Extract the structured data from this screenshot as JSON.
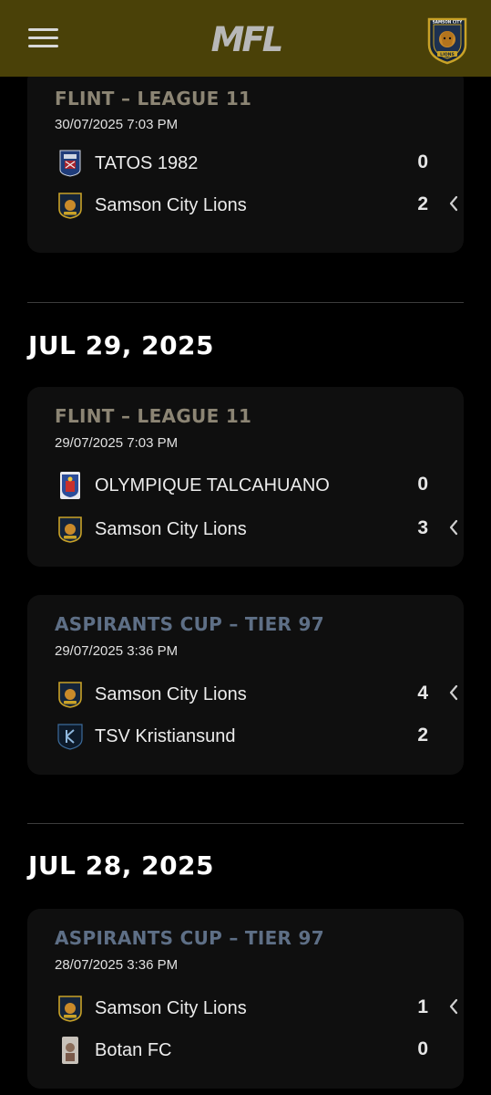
{
  "header": {
    "logo_text": "MFL",
    "club_badge": {
      "top": "SAMSON CITY",
      "bottom": "LIONS"
    }
  },
  "colors": {
    "header_bg": "#4a4108",
    "league_title": "#8c8574",
    "cup_title": "#5e6f86",
    "card_bg": "#0f0f0f"
  },
  "matches": [
    {
      "competition": "FLINT – LEAGUE 11",
      "type": "league",
      "datetime": "30/07/2025 7:03 PM",
      "home": {
        "name": "TATOS 1982",
        "score": "0",
        "logo": "tatos-crest",
        "chevron": false
      },
      "away": {
        "name": "Samson City Lions",
        "score": "2",
        "logo": "lions-crest",
        "chevron": true
      }
    }
  ],
  "day_groups": [
    {
      "heading": "JUL 29, 2025",
      "matches": [
        {
          "competition": "FLINT – LEAGUE 11",
          "type": "league",
          "datetime": "29/07/2025 7:03 PM",
          "home": {
            "name": "OLYMPIQUE TALCAHUANO",
            "score": "0",
            "logo": "olympique-crest",
            "chevron": false
          },
          "away": {
            "name": "Samson City Lions",
            "score": "3",
            "logo": "lions-crest",
            "chevron": true
          }
        },
        {
          "competition": "ASPIRANTS CUP – TIER 97",
          "type": "cup",
          "datetime": "29/07/2025 3:36 PM",
          "home": {
            "name": "Samson City Lions",
            "score": "4",
            "logo": "lions-crest",
            "chevron": true
          },
          "away": {
            "name": "TSV Kristiansund",
            "score": "2",
            "logo": "tsv-crest",
            "chevron": false
          }
        }
      ]
    },
    {
      "heading": "JUL 28, 2025",
      "matches": [
        {
          "competition": "ASPIRANTS CUP – TIER 97",
          "type": "cup",
          "datetime": "28/07/2025 3:36 PM",
          "home": {
            "name": "Samson City Lions",
            "score": "1",
            "logo": "lions-crest",
            "chevron": true
          },
          "away": {
            "name": "Botan FC",
            "score": "0",
            "logo": "botan-crest",
            "chevron": false
          }
        }
      ]
    }
  ]
}
